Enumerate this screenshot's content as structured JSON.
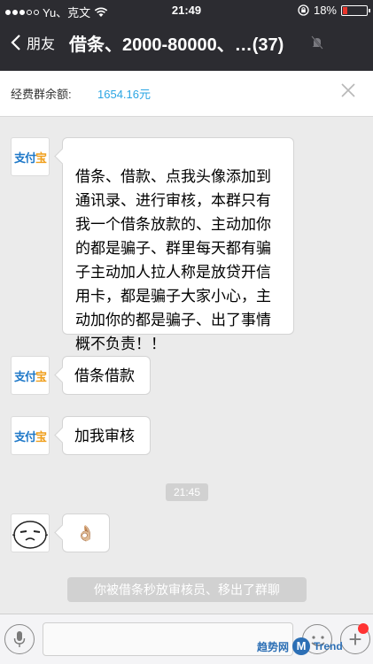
{
  "status_bar": {
    "carrier": "Yu、克文",
    "time": "21:49",
    "battery_text": "18%",
    "battery_level": 0.18,
    "battery_color": "#e8352b"
  },
  "nav": {
    "back_label": "朋友",
    "title": "借条、2000-80000、…(37)",
    "back_icon": "chevron-left-icon",
    "mute_icon": "bell-slash-icon"
  },
  "balance": {
    "label": "经费群余额:",
    "amount": "1654.16元",
    "amount_color": "#2aa5e3",
    "close_icon": "close-icon"
  },
  "messages": [
    {
      "sender_avatar": "支付宝",
      "text": "借条、借款、点我头像添加到通讯录、进行审核，本群只有我一个借条放款的、主动加你的都是骗子、群里每天都有骗子主动加人拉人称是放贷开信用卡，都是骗子大家小心，主动加你的都是骗子、出了事情概不负责！！"
    },
    {
      "sender_avatar": "支付宝",
      "text": "借条借款"
    },
    {
      "sender_avatar": "支付宝",
      "text": "加我审核"
    },
    {
      "sender_avatar": "cartoon-face",
      "text": "👌🏼"
    }
  ],
  "time_separator": "21:45",
  "system_message": "你被借条秒放审核员、移出了群聊",
  "input": {
    "value": "",
    "voice_icon": "microphone-icon",
    "emoji_icon": "smiley-icon",
    "plus_icon": "plus-icon",
    "plus_glyph": "+"
  },
  "watermark": {
    "text": "趋势网",
    "logo_letter": "M",
    "brand": "Trend"
  }
}
